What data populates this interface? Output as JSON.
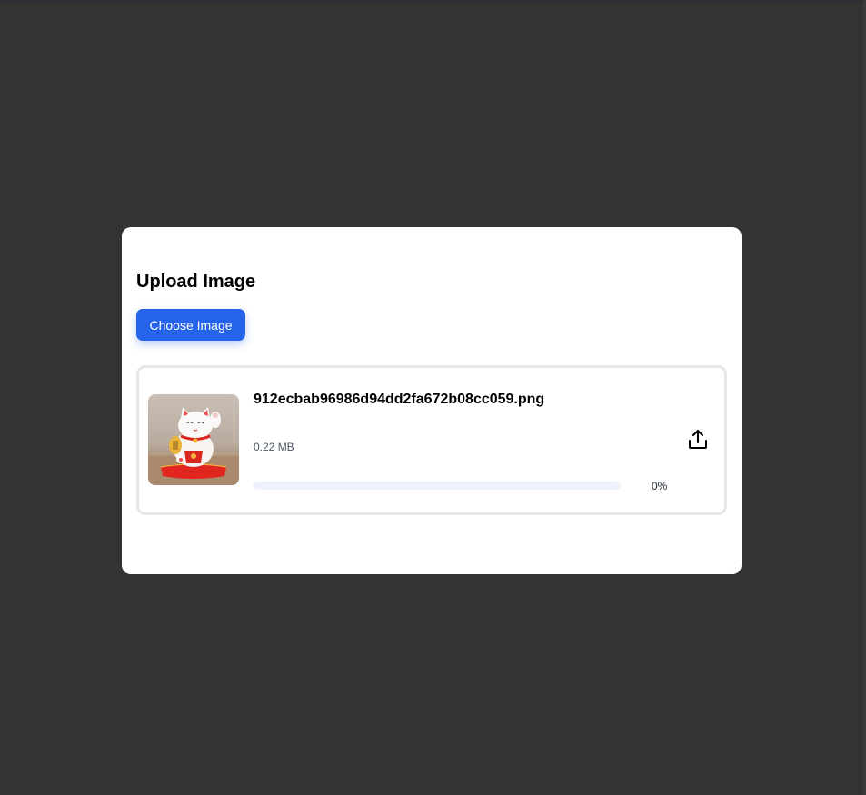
{
  "modal": {
    "title": "Upload Image",
    "choose_button_label": "Choose Image"
  },
  "file": {
    "name": "912ecbab96986d94dd2fa672b08cc059.png",
    "size": "0.22 MB",
    "progress_text": "0%",
    "progress": 0,
    "thumbnail": "lucky-cat-figurine-photo",
    "upload_icon": "upload-icon"
  },
  "colors": {
    "background": "#333333",
    "accent": "#2563eb",
    "card_border": "#e5e7eb",
    "progress_track": "#eef2fb"
  }
}
